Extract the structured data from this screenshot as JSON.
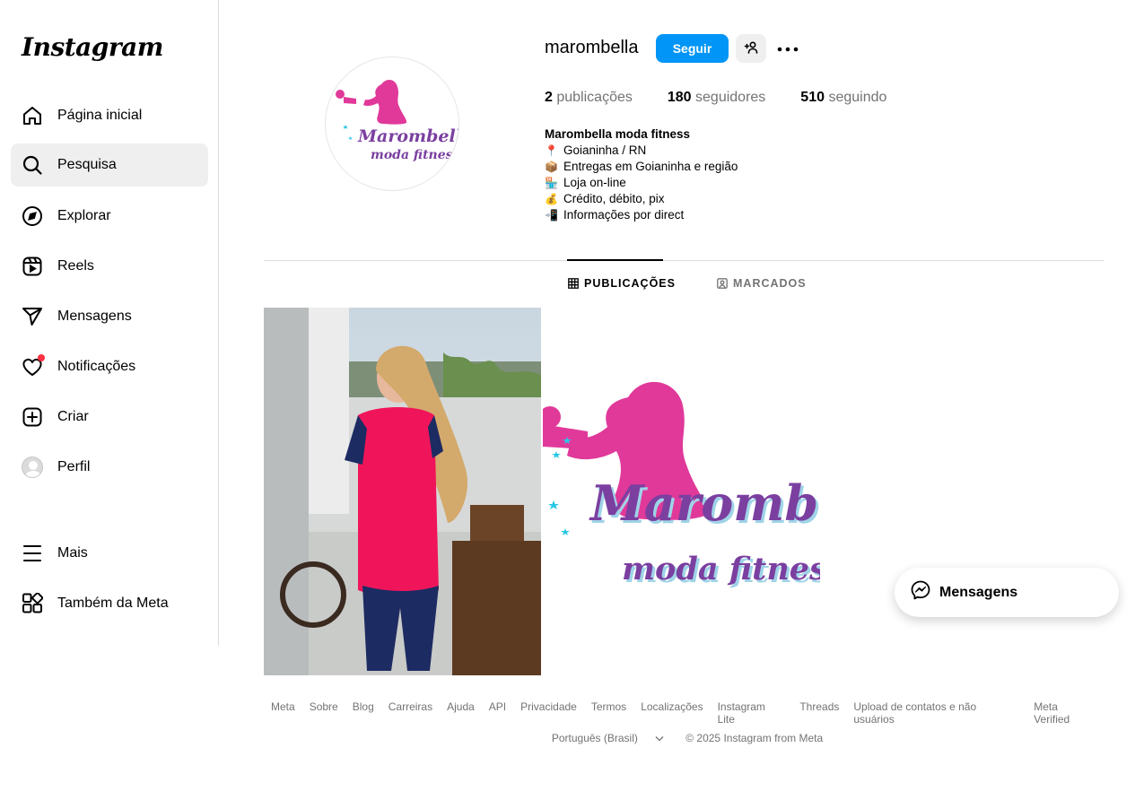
{
  "sidebar": {
    "logo": "Instagram",
    "items": [
      {
        "label": "Página inicial",
        "icon": "home-icon"
      },
      {
        "label": "Pesquisa",
        "icon": "search-icon",
        "active": true
      },
      {
        "label": "Explorar",
        "icon": "compass-icon"
      },
      {
        "label": "Reels",
        "icon": "reels-icon"
      },
      {
        "label": "Mensagens",
        "icon": "send-icon"
      },
      {
        "label": "Notificações",
        "icon": "heart-icon",
        "badge": true
      },
      {
        "label": "Criar",
        "icon": "plus-square-icon"
      },
      {
        "label": "Perfil",
        "icon": "avatar-icon"
      }
    ],
    "bottom": [
      {
        "label": "Mais",
        "icon": "menu-icon"
      },
      {
        "label": "Também da Meta",
        "icon": "meta-apps-icon"
      }
    ]
  },
  "profile": {
    "username": "marombella",
    "follow_label": "Seguir",
    "stats": {
      "posts_count": "2",
      "posts_label": "publicações",
      "followers_count": "180",
      "followers_label": "seguidores",
      "following_count": "510",
      "following_label": "seguindo"
    },
    "bio": {
      "name": "Marombella moda fitness",
      "lines": [
        {
          "emoji": "📍",
          "text": "Goianinha / RN"
        },
        {
          "emoji": "📦",
          "text": "Entregas em Goianinha e região"
        },
        {
          "emoji": "🏪",
          "text": "Loja on-line"
        },
        {
          "emoji": "💰",
          "text": "Crédito, débito, pix"
        },
        {
          "emoji": "📲",
          "text": "Informações por direct"
        }
      ]
    },
    "logo_text": {
      "line1": "Marombella",
      "line2": "moda fitness"
    }
  },
  "tabs": [
    {
      "label": "PUBLICAÇÕES",
      "icon": "grid-icon",
      "active": true
    },
    {
      "label": "MARCADOS",
      "icon": "tagged-icon",
      "active": false
    }
  ],
  "footer": {
    "links": [
      "Meta",
      "Sobre",
      "Blog",
      "Carreiras",
      "Ajuda",
      "API",
      "Privacidade",
      "Termos",
      "Localizações",
      "Instagram Lite",
      "Threads",
      "Upload de contatos e não usuários",
      "Meta Verified"
    ],
    "language": "Português (Brasil)",
    "copyright": "© 2025 Instagram from Meta"
  },
  "messages_pill": {
    "label": "Mensagens"
  },
  "colors": {
    "accent": "#0095f6",
    "brand_pink": "#e0399a",
    "brand_purple": "#7b3fa0",
    "notif": "#ff3040"
  }
}
